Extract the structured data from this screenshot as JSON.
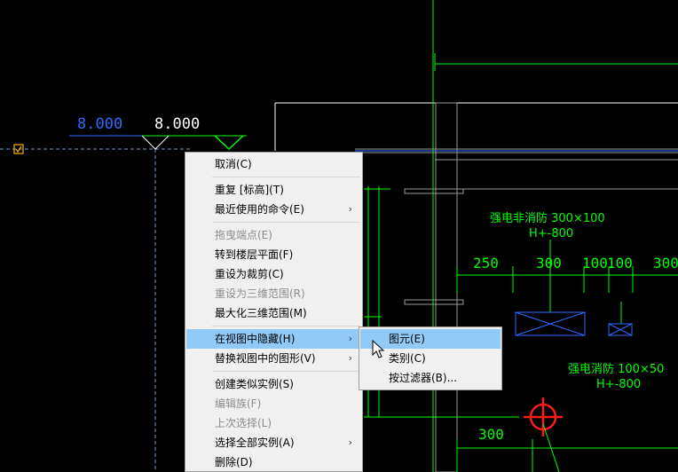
{
  "drawing": {
    "elevations": [
      "8.000",
      "8.000"
    ],
    "dimensions": [
      "250",
      "300",
      "100",
      "100",
      "300",
      "300"
    ],
    "annotations": [
      {
        "name": "强电非消防 300×100",
        "elevation": "H+-800"
      },
      {
        "name": "强电消防 100×50",
        "elevation": "H+-800"
      }
    ],
    "colors": {
      "green": "#00ff00",
      "blue": "#2f6bff",
      "red": "#ff1a1a",
      "white": "#ffffff",
      "grey": "#9a9a9a"
    }
  },
  "context_menu": {
    "items": [
      {
        "label": "取消(C)",
        "disabled": false
      },
      {
        "label": "重复 [标高](T)",
        "disabled": false
      },
      {
        "label": "最近使用的命令(E)",
        "disabled": false,
        "submenu": true
      },
      {
        "label": "拖曳端点(E)",
        "disabled": true
      },
      {
        "label": "转到楼层平面(F)",
        "disabled": false
      },
      {
        "label": "重设为裁剪(C)",
        "disabled": false
      },
      {
        "label": "重设为三维范围(R)",
        "disabled": true
      },
      {
        "label": "最大化三维范围(M)",
        "disabled": false
      },
      {
        "label": "在视图中隐藏(H)",
        "disabled": false,
        "submenu": true,
        "highlighted": true
      },
      {
        "label": "替换视图中的图形(V)",
        "disabled": false,
        "submenu": true
      },
      {
        "label": "创建类似实例(S)",
        "disabled": false
      },
      {
        "label": "编辑族(F)",
        "disabled": true
      },
      {
        "label": "上次选择(L)",
        "disabled": true
      },
      {
        "label": "选择全部实例(A)",
        "disabled": false,
        "submenu": true
      },
      {
        "label": "删除(D)",
        "disabled": false
      }
    ],
    "submenu_arrow": "›"
  },
  "submenu": {
    "items": [
      {
        "label": "图元(E)",
        "highlighted": true
      },
      {
        "label": "类别(C)",
        "highlighted": false
      },
      {
        "label": "按过滤器(B)...",
        "highlighted": false
      }
    ]
  }
}
